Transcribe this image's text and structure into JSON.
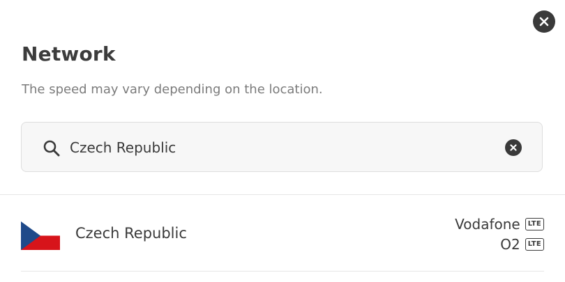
{
  "dialog": {
    "title": "Network",
    "subtitle": "The speed may vary depending on the location."
  },
  "search": {
    "value": "Czech Republic"
  },
  "results": [
    {
      "country": "Czech Republic",
      "flag": "czech-flag",
      "operators": [
        {
          "name": "Vodafone",
          "badge": "LTE"
        },
        {
          "name": "O2",
          "badge": "LTE"
        }
      ]
    }
  ],
  "colors": {
    "text": "#3a3a3a",
    "muted": "#7b7b7b",
    "search_bg": "#f7f7f7",
    "flag_blue": "#1f4a8a",
    "flag_red": "#d7141a"
  }
}
